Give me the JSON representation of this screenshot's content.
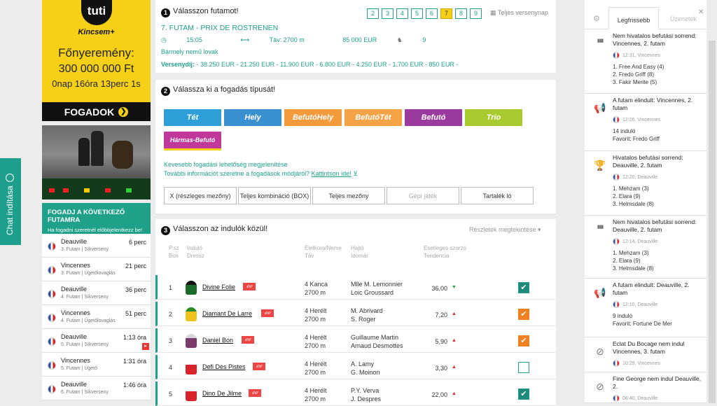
{
  "chat": {
    "label": "Chat indítása"
  },
  "ad": {
    "logo": "tuti",
    "brand": "Kincsem+",
    "jackpot_label": "Főnyeremény:",
    "jackpot_amount": "300 000 000 Ft",
    "countdown": "0nap 16óra 13perc 1s",
    "bet_button": "FOGADOK"
  },
  "next_races": {
    "title": "FOGADJ A KÖVETKEZŐ FUTAMRA",
    "subtitle": "Ha fogadni szeretnél előbbjelentkezz be!",
    "items": [
      {
        "venue": "Deauville",
        "sub": "3. Futam | Síkverseny",
        "time": "6 perc"
      },
      {
        "venue": "Vincennes",
        "sub": "3. Futam | Ügetőlovaglás",
        "time": "21 perc"
      },
      {
        "venue": "Deauville",
        "sub": "4. Futam | Síkverseny",
        "time": "36 perc"
      },
      {
        "venue": "Vincennes",
        "sub": "4. Futam | Ügetőlovaglás",
        "time": "51 perc"
      },
      {
        "venue": "Deauville",
        "sub": "5. Futam | Síkverseny",
        "time": "1:13 óra"
      },
      {
        "venue": "Vincennes",
        "sub": "5. Futam | Ügető",
        "time": "1:31 óra"
      },
      {
        "venue": "Deauville",
        "sub": "6. Futam | Síkverseny",
        "time": "1:46 óra"
      }
    ]
  },
  "step1": {
    "num": "1",
    "heading": "Válasszon futamot!",
    "race_tabs": [
      "2",
      "3",
      "4",
      "5",
      "6",
      "7",
      "8",
      "9"
    ],
    "full_program": "Teljes versenynap",
    "race_title": "7. FUTAM - PRIX DE ROSTRENEN",
    "time": "15:05",
    "distance": "Táv: 2700 m",
    "prize": "85 000 EUR",
    "runners": "9",
    "conditions": "Bármely nemű lovak",
    "prizes_label": "Versenydíj:",
    "prizes_value": " - 38.250 EUR - 21.250 EUR - 11.900 EUR - 6.800 EUR - 4.250 EUR - 1.700 EUR - 850 EUR -"
  },
  "step2": {
    "num": "2",
    "heading": "Válassza ki a fogadás típusát!",
    "bet_types": [
      {
        "label": "Tét",
        "color": "#2f9fd8"
      },
      {
        "label": "Hely",
        "color": "#3a8fd1"
      },
      {
        "label": "BefutóHely",
        "color": "#f39a3c"
      },
      {
        "label": "BefutóTét",
        "color": "#f5a347"
      },
      {
        "label": "Befutó",
        "color": "#9b3a9e"
      },
      {
        "label": "Trio",
        "color": "#aacb2f"
      },
      {
        "label": "Hármas-Befutó",
        "color": "#c0399a"
      }
    ],
    "fewer_options": "Kevesebb fogadási lehetőség megjelenítése",
    "more_info": "További információt szeretne a fogadások módjáról?",
    "more_info_link": "Kattintson ide!",
    "modes": [
      "X (részleges mezőny)",
      "Teljes kombináció (BOX)",
      "Teljes mezőny",
      "Gépi játék",
      "Tartalék ló"
    ]
  },
  "step3": {
    "num": "3",
    "heading": "Válasszon az indulók közül!",
    "details_link": "Részletek megtekintése",
    "columns": {
      "c1a": "P.sz",
      "c1b": "Box",
      "c2a": "Induló",
      "c2b": "Dressz",
      "c3a": "Életkora/Neme",
      "c3b": "Táv",
      "c4a": "Hajtó",
      "c4b": "Idomár",
      "c5a": "Esetleges szorzó",
      "c5b": "Tendencia"
    },
    "runners": [
      {
        "num": "1",
        "name": "Divine Folie",
        "age": "4 Kanca",
        "dist": "2700 m",
        "driver": "Mlle M. Lemonnier",
        "trainer": "Loic Groussard",
        "odds": "36,00",
        "trend": "down",
        "check": "on"
      },
      {
        "num": "2",
        "name": "Diamant De Larre",
        "age": "4 Herélt",
        "dist": "2700 m",
        "driver": "M. Abrivard",
        "trainer": "S. Roger",
        "odds": "7,20",
        "trend": "up",
        "check": "orange"
      },
      {
        "num": "3",
        "name": "Daniel Bon",
        "age": "4 Herélt",
        "dist": "2700 m",
        "driver": "Guillaume Martin",
        "trainer": "Arnaud Desmottes",
        "odds": "5,90",
        "trend": "up",
        "check": "orange"
      },
      {
        "num": "4",
        "name": "Defi Des Pistes",
        "age": "4 Herélt",
        "dist": "2700 m",
        "driver": "A. Lamy",
        "trainer": "G. Moinon",
        "odds": "3,30",
        "trend": "up",
        "check": "off"
      },
      {
        "num": "5",
        "name": "Dino De Jilme",
        "age": "4 Herélt",
        "dist": "2700 m",
        "driver": "P.Y. Verva",
        "trainer": "J. Despres",
        "odds": "22,00",
        "trend": "up",
        "check": "on"
      }
    ]
  },
  "sidebar": {
    "tab_latest": "Legfrissebb",
    "tab_messages": "Üzenetek",
    "notifications": [
      {
        "icon": "chart",
        "title": "Nem hivatalos befutási sorrend: Vincennes, 2. futam",
        "meta": "12:31, Vincennes",
        "lines": [
          "1. Free And Easy (4)",
          "2. Fredo Griff (8)",
          "3. Fakir Merite (5)"
        ]
      },
      {
        "icon": "megaphone",
        "title": "A futam elindult: Vincennes, 2. futam",
        "meta": "12:26, Vincennes",
        "lines": [
          "14 induló",
          "Favorit: Fredo Griff"
        ]
      },
      {
        "icon": "trophy",
        "title": "Hivatalos befutási sorrend: Deauville, 2. futam",
        "meta": "12:20, Deauville",
        "lines": [
          "1. Mehzam (3)",
          "2. Elara (9)",
          "3. Helmsdale (8)"
        ]
      },
      {
        "icon": "chart",
        "title": "Nem hivatalos befutási sorrend: Deauville, 2. futam",
        "meta": "12:14, Deauville",
        "lines": [
          "1. Mehzam (3)",
          "2. Elara (9)",
          "3. Helmsdale (8)"
        ]
      },
      {
        "icon": "megaphone",
        "title": "A futam elindult: Deauville, 2. futam",
        "meta": "12:10, Deauville",
        "lines": [
          "9 induló",
          "Favorit: Fortune De Mer"
        ]
      },
      {
        "icon": "ban",
        "title": "Eclat Du Bocage nem indul Vincennes, 3. futam",
        "meta": "10:29, Vincennes",
        "lines": []
      },
      {
        "icon": "ban",
        "title": "Fine George nem indul Deauville, 2.",
        "meta": "08:40, Deauville",
        "lines": []
      }
    ]
  }
}
